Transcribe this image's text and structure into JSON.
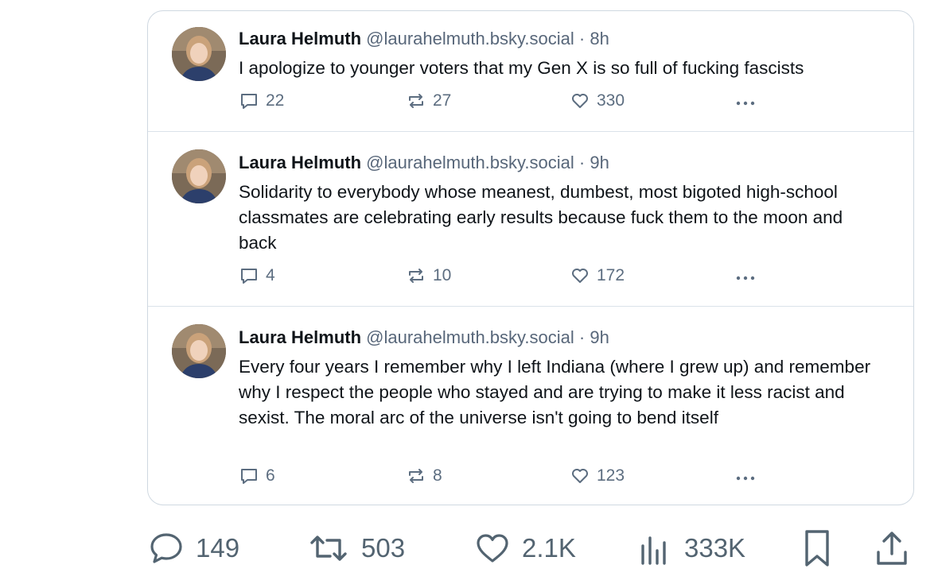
{
  "posts": [
    {
      "author": "Laura Helmuth",
      "handle": "@laurahelmuth.bsky.social",
      "separator": "·",
      "time": "8h",
      "text": "I apologize to younger voters that my Gen X is so full of fucking fascists",
      "replies": "22",
      "reposts": "27",
      "likes": "330"
    },
    {
      "author": "Laura Helmuth",
      "handle": "@laurahelmuth.bsky.social",
      "separator": "·",
      "time": "9h",
      "text": "Solidarity to everybody whose meanest, dumbest, most bigoted high-school classmates are celebrating early results because fuck them to the moon and back",
      "replies": "4",
      "reposts": "10",
      "likes": "172"
    },
    {
      "author": "Laura Helmuth",
      "handle": "@laurahelmuth.bsky.social",
      "separator": "·",
      "time": "9h",
      "text": "Every four years I remember why I left Indiana (where I grew up) and remember why I respect the people who stayed and are trying to make it less racist and sexist. The moral arc of the universe isn't going to bend itself",
      "replies": "6",
      "reposts": "8",
      "likes": "123"
    }
  ],
  "engagement": {
    "replies": "149",
    "reposts": "503",
    "likes": "2.1K",
    "views": "333K"
  },
  "icons": {
    "post_reply": "comment-icon",
    "post_repost": "repost-icon",
    "post_like": "heart-icon",
    "post_more": "more-icon",
    "bar_reply": "comment-icon",
    "bar_repost": "repost-icon",
    "bar_like": "heart-icon",
    "bar_views": "views-chart-icon",
    "bar_bookmark": "bookmark-icon",
    "bar_share": "share-icon"
  },
  "colors": {
    "text": "#0f1419",
    "muted": "#58677a",
    "border": "#cfd8e1",
    "icon": "#536471"
  }
}
